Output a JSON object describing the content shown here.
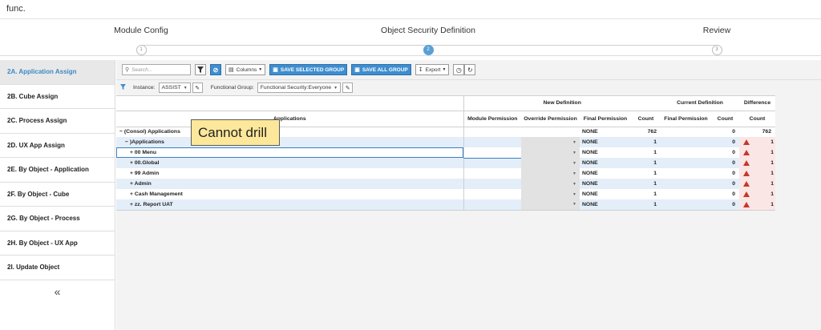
{
  "window": {
    "title": "func."
  },
  "stepper": {
    "steps": [
      {
        "label": "Module Config",
        "number": "1"
      },
      {
        "label": "Object Security Definition",
        "number": "2",
        "active": true
      },
      {
        "label": "Review",
        "number": "3"
      }
    ]
  },
  "sidebar": {
    "items": [
      {
        "label": "2A.  Application Assign",
        "active": true
      },
      {
        "label": "2B.  Cube Assign"
      },
      {
        "label": "2C.  Process Assign"
      },
      {
        "label": "2D.  UX App Assign"
      },
      {
        "label": "2E.  By Object - Application"
      },
      {
        "label": "2F.  By Object - Cube"
      },
      {
        "label": "2G.  By Object - Process"
      },
      {
        "label": "2H.  By Object - UX App"
      },
      {
        "label": "2I.  Update Object"
      }
    ],
    "collapse_glyph": "«"
  },
  "toolbar": {
    "search_placeholder": "Search...",
    "columns_label": "Columns",
    "save_selected_label": "SAVE SELECTED GROUP",
    "save_all_label": "SAVE ALL GROUP",
    "export_label": "Export"
  },
  "filterbar": {
    "instance_label": "Instance:",
    "instance_value": "ASSIST",
    "group_label": "Functional Group:",
    "group_value": "Functional Security:Everyone"
  },
  "grid": {
    "group_headers": {
      "new_definition": "New Definition",
      "current_definition": "Current Definition",
      "difference": "Difference"
    },
    "columns": {
      "applications": "Applications",
      "module_permission": "Module Permission",
      "override_permission": "Override Permission",
      "final_permission_new": "Final Permission",
      "count_new": "Count",
      "final_permission_current": "Final Permission",
      "count_current": "Count",
      "count_diff": "Count"
    },
    "rows": [
      {
        "expander": "−",
        "app": "(Consol) Applications",
        "final_new": "NONE",
        "count_new": "762",
        "count_current": "0",
        "count_diff": "762",
        "warn": false
      },
      {
        "expander": "−",
        "app": ")Applications",
        "final_new": "NONE",
        "count_new": "1",
        "count_current": "0",
        "count_diff": "1",
        "warn": true
      },
      {
        "expander": "+",
        "app": "00 Menu",
        "final_new": "NONE",
        "count_new": "1",
        "count_current": "0",
        "count_diff": "1",
        "warn": true
      },
      {
        "expander": "+",
        "app": "00.Global",
        "final_new": "NONE",
        "count_new": "1",
        "count_current": "0",
        "count_diff": "1",
        "warn": true
      },
      {
        "expander": "+",
        "app": "99 Admin",
        "final_new": "NONE",
        "count_new": "1",
        "count_current": "0",
        "count_diff": "1",
        "warn": true
      },
      {
        "expander": "+",
        "app": "Admin",
        "final_new": "NONE",
        "count_new": "1",
        "count_current": "0",
        "count_diff": "1",
        "warn": true
      },
      {
        "expander": "+",
        "app": "Cash Management",
        "final_new": "NONE",
        "count_new": "1",
        "count_current": "0",
        "count_diff": "1",
        "warn": true
      },
      {
        "expander": "+",
        "app": "zz. Report UAT",
        "final_new": "NONE",
        "count_new": "1",
        "count_current": "0",
        "count_diff": "1",
        "warn": true
      }
    ]
  },
  "annotation": {
    "text": "Cannot drill"
  },
  "colors": {
    "accent": "#3e8ed0",
    "active_tab_text": "#3b89c5",
    "row_alt": "#e3eef9",
    "warning": "#c9362a",
    "diff_bg": "#fbe6e6",
    "tooltip_bg": "#fde79a"
  }
}
